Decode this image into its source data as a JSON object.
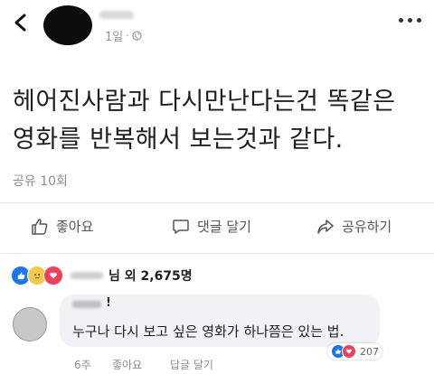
{
  "header": {
    "meta_time": "1일",
    "meta_dot": "·"
  },
  "post": {
    "text_line1": "헤어진사람과 다시만난다는건 똑같은",
    "text_line2": "영화를 반복해서 보는것과 같다.",
    "share_count": "공유 10회"
  },
  "actions": {
    "like_label": "좋아요",
    "comment_label": "댓글 달기",
    "share_label": "공유하기"
  },
  "reactions": {
    "summary_text": "님 외 2,675명"
  },
  "comment": {
    "name_suffix": "!",
    "text": "누구나 다시 보고 싶은 영화가 하나쯤은 있는 법.",
    "reaction_count": "207",
    "time": "6주",
    "like_label": "좋아요",
    "reply_label": "답글 달기"
  },
  "colors": {
    "like": "#1877f2",
    "sad": "#f7c948",
    "love": "#f33e58"
  }
}
